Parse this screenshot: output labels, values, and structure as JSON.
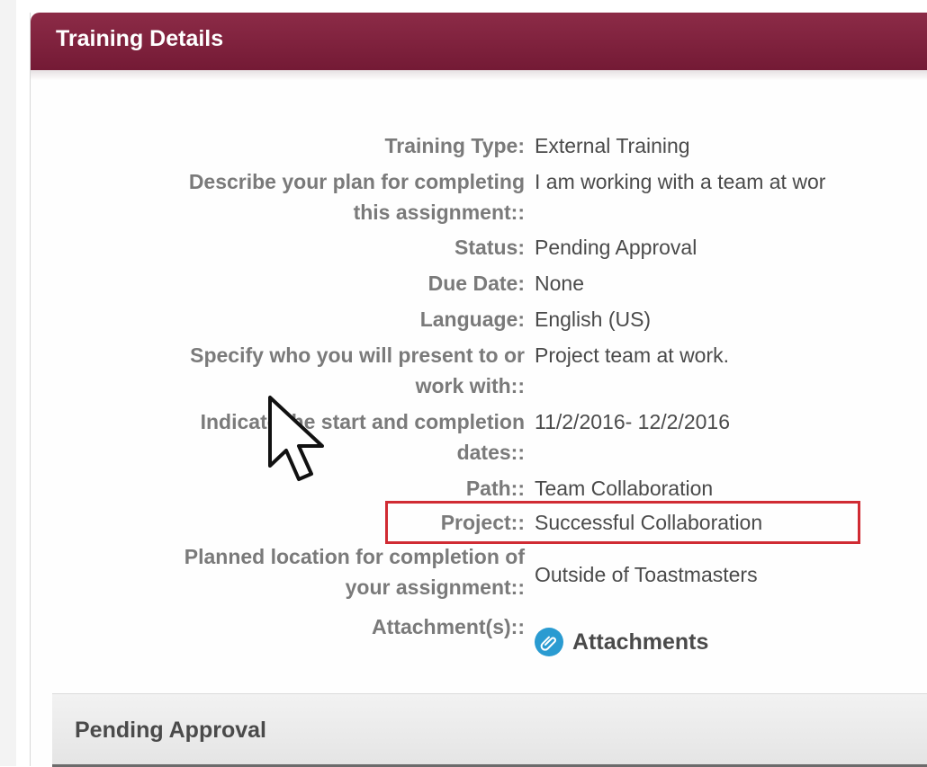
{
  "panel": {
    "title": "Training Details"
  },
  "details": [
    {
      "label": "Training Type:",
      "value": "External Training"
    },
    {
      "label_line1": "Describe your plan for completing",
      "label_line2": "this assignment::",
      "value": "I am working with a team at wor"
    },
    {
      "label": "Status:",
      "value": "Pending Approval"
    },
    {
      "label": "Due Date:",
      "value": "None"
    },
    {
      "label": "Language:",
      "value": "English (US)"
    },
    {
      "label_line1": "Specify who you will present to or",
      "label_line2": "work with::",
      "value": "Project team at work."
    },
    {
      "label_line1": "Indicate the start and completion",
      "label_line2": "dates::",
      "value": "11/2/2016- 12/2/2016"
    },
    {
      "label": "Path::",
      "value": "Team Collaboration"
    },
    {
      "label": "Project::",
      "value": "Successful Collaboration"
    },
    {
      "label_line1": "Planned location for completion of",
      "label_line2": "your assignment::",
      "value": "Outside of Toastmasters"
    },
    {
      "label": "Attachment(s)::",
      "link_label": "Attachments",
      "icon": "paperclip-icon"
    }
  ],
  "pending": {
    "title": "Pending Approval"
  },
  "colors": {
    "header": "#7d2140",
    "highlight": "#d02b33",
    "attachment_icon": "#2a9bd1"
  }
}
